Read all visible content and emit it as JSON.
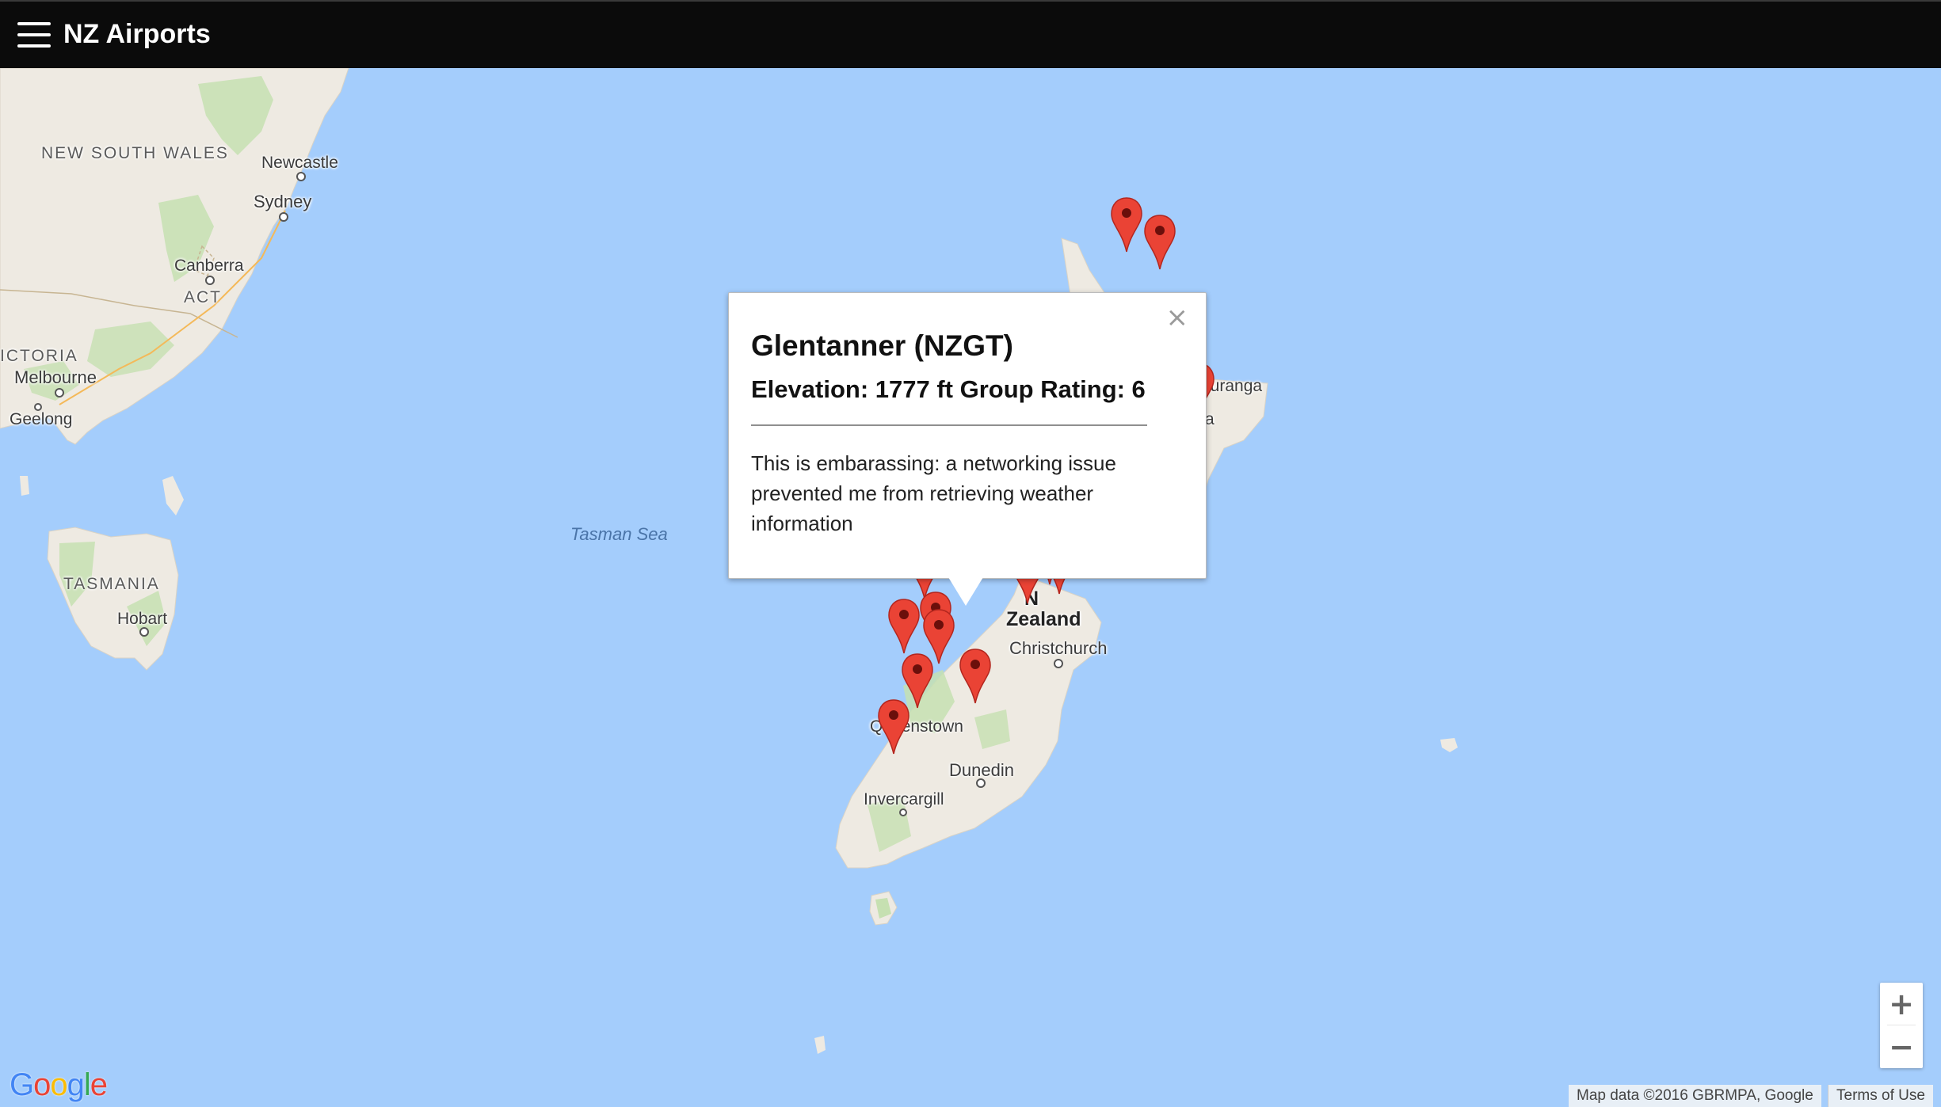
{
  "app": {
    "title": "NZ Airports"
  },
  "map": {
    "places": {
      "nsw": "NEW SOUTH WALES",
      "newcastle": "Newcastle",
      "sydney": "Sydney",
      "canberra": "Canberra",
      "act": "ACT",
      "victoria": "ICTORIA",
      "melbourne": "Melbourne",
      "geelong": "Geelong",
      "tasmania": "TASMANIA",
      "hobart": "Hobart",
      "tasman_sea": "Tasman Sea",
      "tauranga": "auranga",
      "nz_line1": "N",
      "nz_line2": "Zealand",
      "christchurch": "Christchurch",
      "queenstown": "Queenstown",
      "dunedin": "Dunedin",
      "invercargill": "Invercargill",
      "napier": "a"
    },
    "colors": {
      "water": "#a4cdfc",
      "land": "#eeeae2",
      "marker": "#ea4335",
      "green": "#c6e0b1"
    },
    "markers": [
      "airport-marker",
      "airport-marker",
      "airport-marker",
      "airport-marker",
      "airport-marker",
      "airport-marker",
      "airport-marker",
      "airport-marker",
      "airport-marker",
      "airport-marker",
      "airport-marker",
      "airport-marker",
      "airport-marker",
      "airport-marker",
      "airport-marker"
    ]
  },
  "popup": {
    "title": "Glentanner (NZGT)",
    "subtitle": "Elevation: 1777 ft Group Rating: 6",
    "body": "This is embarassing: a networking issue prevented me from retrieving weather information",
    "close_label": "×"
  },
  "controls": {
    "zoom_in": "+",
    "zoom_out": "−"
  },
  "footer": {
    "logo": "Google",
    "map_data": "Map data ©2016 GBRMPA, Google",
    "terms": "Terms of Use"
  }
}
